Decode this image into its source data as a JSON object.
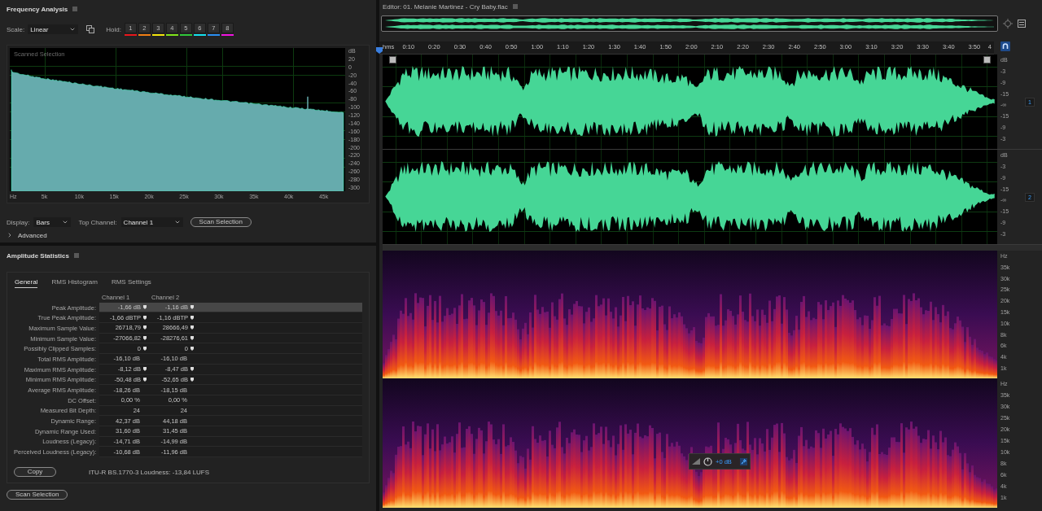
{
  "frequency_analysis": {
    "title": "Frequency Analysis",
    "scale_label": "Scale:",
    "scale": "Linear",
    "hold_label": "Hold:",
    "holds": [
      {
        "label": "1",
        "color": "#e8161c"
      },
      {
        "label": "2",
        "color": "#f07d14"
      },
      {
        "label": "3",
        "color": "#f2e40c"
      },
      {
        "label": "4",
        "color": "#7fe41a"
      },
      {
        "label": "5",
        "color": "#2fc63a"
      },
      {
        "label": "6",
        "color": "#14e0ee"
      },
      {
        "label": "7",
        "color": "#2a8ef0"
      },
      {
        "label": "8",
        "color": "#f014e0"
      }
    ],
    "chart": {
      "caption": "Scanned Selection",
      "y_labels": [
        "dB",
        "20",
        "0",
        "-20",
        "-40",
        "-60",
        "-80",
        "-100",
        "-120",
        "-140",
        "-160",
        "-180",
        "-200",
        "-220",
        "-240",
        "-260",
        "-280",
        "-300"
      ],
      "x_labels": [
        "Hz",
        "5k",
        "10k",
        "15k",
        "20k",
        "25k",
        "30k",
        "35k",
        "40k",
        "45k"
      ]
    },
    "display_label": "Display:",
    "display": "Bars",
    "top_channel_label": "Top Channel:",
    "top_channel": "Channel 1",
    "scan_button": "Scan Selection",
    "advanced": {
      "label": "Advanced",
      "expanded": false
    }
  },
  "amplitude_statistics": {
    "title": "Amplitude Statistics",
    "tabs": [
      {
        "label": "General",
        "selected": true
      },
      {
        "label": "RMS Histogram",
        "selected": false
      },
      {
        "label": "RMS Settings",
        "selected": false
      }
    ],
    "columns": [
      "Channel 1",
      "Channel 2"
    ],
    "rows": [
      {
        "label": "Peak Amplitude:",
        "values": [
          "-1,66 dB",
          "-1,16 dB"
        ],
        "marker": true,
        "selected": true
      },
      {
        "label": "True Peak Amplitude:",
        "values": [
          "-1,66 dBTP",
          "-1,16 dBTP"
        ],
        "marker": true,
        "selected": false
      },
      {
        "label": "Maximum Sample Value:",
        "values": [
          "26718,79",
          "28666,49"
        ],
        "marker": true,
        "selected": false
      },
      {
        "label": "Minimum Sample Value:",
        "values": [
          "-27066,82",
          "-28276,61"
        ],
        "marker": true,
        "selected": false
      },
      {
        "label": "Possibly Clipped Samples:",
        "values": [
          "0",
          "0"
        ],
        "marker": true,
        "selected": false
      },
      {
        "label": "Total RMS Amplitude:",
        "values": [
          "-16,10 dB",
          "-16,10 dB"
        ],
        "marker": false,
        "selected": false
      },
      {
        "label": "Maximum RMS Amplitude:",
        "values": [
          "-8,12 dB",
          "-8,47 dB"
        ],
        "marker": true,
        "selected": false
      },
      {
        "label": "Minimum RMS Amplitude:",
        "values": [
          "-50,48 dB",
          "-52,65 dB"
        ],
        "marker": true,
        "selected": false
      },
      {
        "label": "Average RMS Amplitude:",
        "values": [
          "-18,26 dB",
          "-18,15 dB"
        ],
        "marker": false,
        "selected": false
      },
      {
        "label": "DC Offset:",
        "values": [
          "0,00 %",
          "0,00 %"
        ],
        "marker": false,
        "selected": false
      },
      {
        "label": "Measured Bit Depth:",
        "values": [
          "24",
          "24"
        ],
        "marker": false,
        "selected": false
      },
      {
        "label": "Dynamic Range:",
        "values": [
          "42,37 dB",
          "44,18 dB"
        ],
        "marker": false,
        "selected": false
      },
      {
        "label": "Dynamic Range Used:",
        "values": [
          "31,60 dB",
          "31,45 dB"
        ],
        "marker": false,
        "selected": false
      },
      {
        "label": "Loudness (Legacy):",
        "values": [
          "-14,71 dB",
          "-14,99 dB"
        ],
        "marker": false,
        "selected": false
      },
      {
        "label": "Perceived Loudness (Legacy):",
        "values": [
          "-10,68 dB",
          "-11,96 dB"
        ],
        "marker": false,
        "selected": false
      }
    ],
    "copy_button": "Copy",
    "loudness": "ITU-R BS.1770-3 Loudness: -13,84 LUFS",
    "scan_button": "Scan Selection"
  },
  "editor": {
    "title": "Editor: 01. Melanie Martinez - Cry Baby.flac",
    "ruler_labels": [
      "hms",
      "0:10",
      "0:20",
      "0:30",
      "0:40",
      "0:50",
      "1:00",
      "1:10",
      "1:20",
      "1:30",
      "1:40",
      "1:50",
      "2:00",
      "2:10",
      "2:20",
      "2:30",
      "2:40",
      "2:50",
      "3:00",
      "3:10",
      "3:20",
      "3:30",
      "3:40",
      "3:50",
      "4"
    ],
    "channels": [
      {
        "label": "1",
        "db_labels": [
          "dB",
          "-3",
          "-9",
          "-15",
          "-∞",
          "-15",
          "-9",
          "-3"
        ]
      },
      {
        "label": "2",
        "db_labels": [
          "dB",
          "-3",
          "-9",
          "-15",
          "-∞",
          "-15",
          "-9",
          "-3"
        ]
      }
    ],
    "spectrograms": [
      {
        "hz_labels": [
          "Hz",
          "35k",
          "30k",
          "25k",
          "20k",
          "15k",
          "10k",
          "8k",
          "6k",
          "4k",
          "1k"
        ]
      },
      {
        "hz_labels": [
          "Hz",
          "35k",
          "30k",
          "25k",
          "20k",
          "15k",
          "10k",
          "8k",
          "6k",
          "4k",
          "1k"
        ]
      }
    ],
    "hud": {
      "gain": "+0 dB"
    }
  }
}
